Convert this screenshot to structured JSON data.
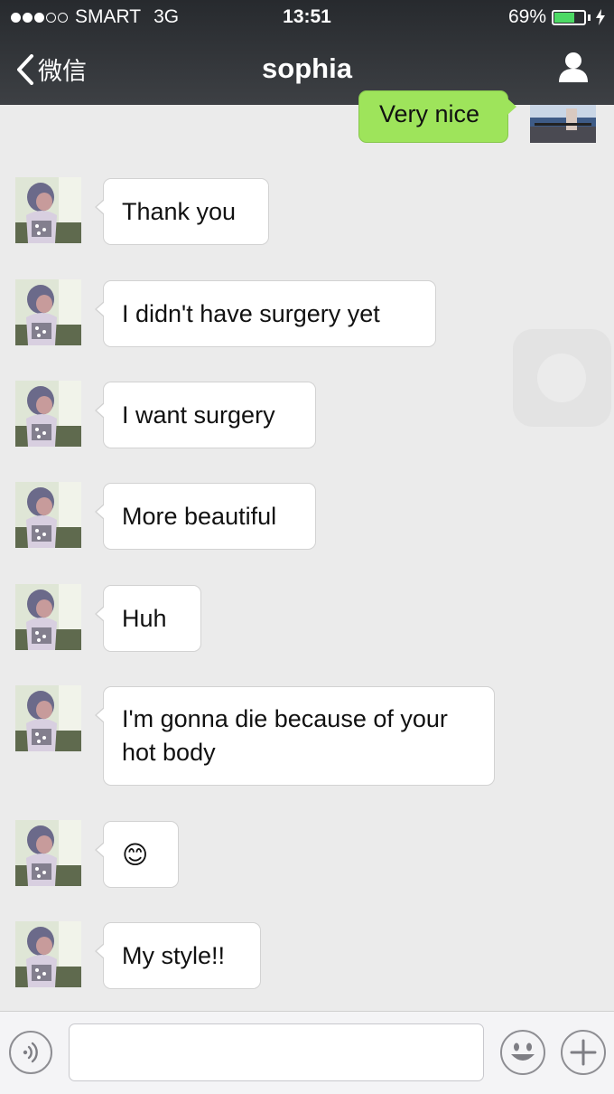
{
  "status_bar": {
    "carrier": "SMART",
    "network": "3G",
    "time": "13:51",
    "battery_percent": "69%",
    "battery_level": 0.69,
    "signal_bars_filled": 3,
    "signal_bars_total": 5
  },
  "nav": {
    "back_label": "微信",
    "title": "sophia"
  },
  "sent_messages": [
    {
      "text": "Very nice"
    }
  ],
  "messages": [
    {
      "text": "Thank you"
    },
    {
      "text": "I didn't have surgery yet"
    },
    {
      "text": "I want surgery"
    },
    {
      "text": "More beautiful"
    },
    {
      "text": "Huh"
    },
    {
      "text": "I'm gonna die because of your hot body"
    },
    {
      "text": "😊"
    },
    {
      "text": "My style!!"
    }
  ],
  "input": {
    "value": "",
    "placeholder": ""
  },
  "colors": {
    "nav_background": "#2e3135",
    "sent_bubble": "#9ee45b",
    "received_bubble": "#ffffff",
    "chat_background": "#ebebeb",
    "battery": "#4cd964"
  },
  "icons": [
    "back-chevron-icon",
    "profile-icon",
    "voice-icon",
    "emoji-icon",
    "plus-icon"
  ]
}
